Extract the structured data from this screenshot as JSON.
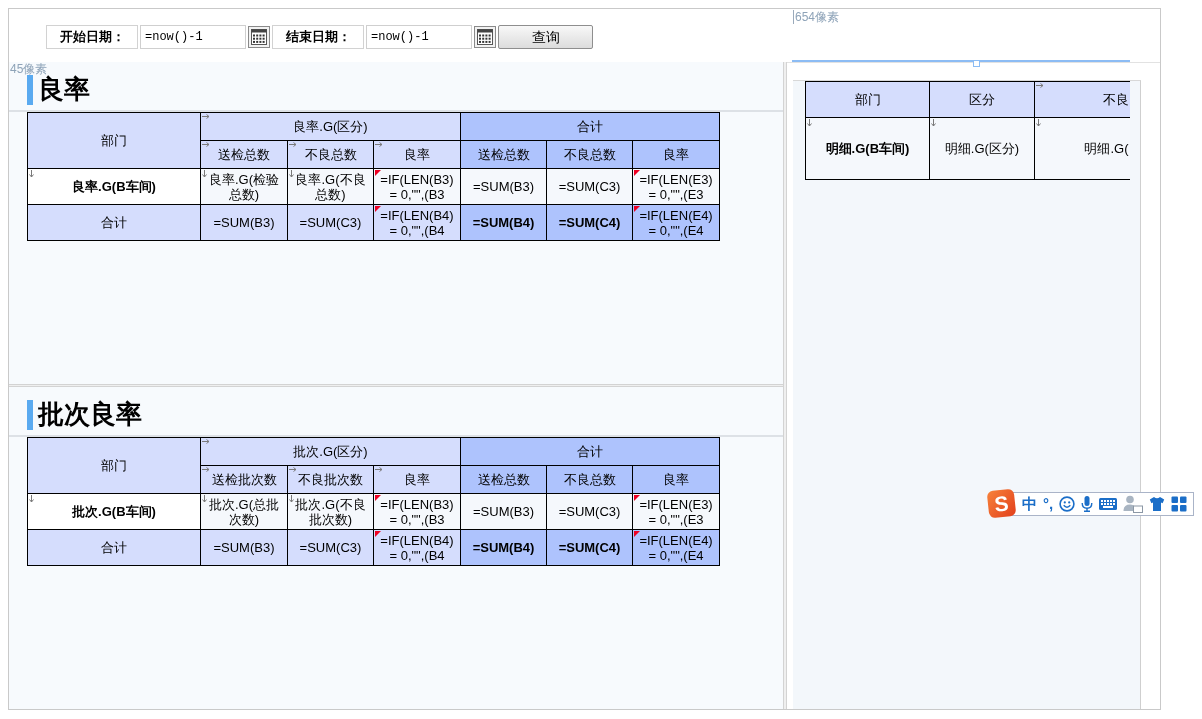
{
  "parameter_bar": {
    "fields": [
      {
        "label": "开始日期：",
        "value": "=now()-1"
      },
      {
        "label": "结束日期：",
        "value": "=now()-1"
      }
    ],
    "query_button": "查询"
  },
  "ruler_labels": {
    "width": "654像素",
    "height": "45像素"
  },
  "reports": [
    {
      "title": "良率",
      "table": {
        "rows": [
          {
            "kind": "header",
            "cells": [
              {
                "text": "部门",
                "rowspan": 2,
                "color": "#d5ddfd",
                "kind": "plain"
              },
              {
                "text": "良率.G(区分)",
                "colspan": 3,
                "color": "#d5ddfd",
                "kind": "expand_across"
              },
              {
                "text": "合计",
                "colspan": 3,
                "color": "#aec3fd",
                "kind": "plain"
              }
            ]
          },
          {
            "kind": "header",
            "cells": [
              {
                "text": "送检总数",
                "color": "#d5ddfd",
                "kind": "expand_across"
              },
              {
                "text": "不良总数",
                "color": "#d5ddfd",
                "kind": "expand_across"
              },
              {
                "text": "良率",
                "color": "#d5ddfd",
                "kind": "expand_across"
              },
              {
                "text": "送检总数",
                "color": "#aec3fd",
                "kind": "plain"
              },
              {
                "text": "不良总数",
                "color": "#aec3fd",
                "kind": "plain"
              },
              {
                "text": "良率",
                "color": "#aec3fd",
                "kind": "plain"
              }
            ]
          },
          {
            "kind": "data",
            "cells": [
              {
                "text": "良率.G(B车间)",
                "color": "#ffffff",
                "bold": true,
                "kind": "expand_down"
              },
              {
                "text": "良率.G(检验总数)",
                "color": "#f5f8fc",
                "kind": "expand_down"
              },
              {
                "text": "良率.G(不良总数)",
                "color": "#f5f8fc",
                "kind": "expand_down"
              },
              {
                "text": "=IF(LEN(B3) = 0,\"\",(B3",
                "color": "#f5f8fc",
                "kind": "comment"
              },
              {
                "text": "=SUM(B3)",
                "color": "#f5f8fc",
                "kind": "plain"
              },
              {
                "text": "=SUM(C3)",
                "color": "#f5f8fc",
                "kind": "plain"
              },
              {
                "text": "=IF(LEN(E3) = 0,\"\",(E3",
                "color": "#f5f8fc",
                "kind": "comment"
              }
            ]
          },
          {
            "kind": "total",
            "cells": [
              {
                "text": "合计",
                "color": "#d5ddfd",
                "kind": "plain"
              },
              {
                "text": "=SUM(B3)",
                "color": "#d5ddfd",
                "kind": "plain"
              },
              {
                "text": "=SUM(C3)",
                "color": "#d5ddfd",
                "kind": "plain"
              },
              {
                "text": "=IF(LEN(B4) = 0,\"\",(B4",
                "color": "#d5ddfd",
                "kind": "comment"
              },
              {
                "text": "=SUM(B4)",
                "color": "#aec3fd",
                "bold": true,
                "kind": "plain"
              },
              {
                "text": "=SUM(C4)",
                "color": "#aec3fd",
                "bold": true,
                "kind": "plain"
              },
              {
                "text": "=IF(LEN(E4) = 0,\"\",(E4",
                "color": "#aec3fd",
                "kind": "comment"
              }
            ]
          }
        ]
      }
    },
    {
      "title": "批次良率",
      "table": {
        "rows": [
          {
            "kind": "header",
            "cells": [
              {
                "text": "部门",
                "rowspan": 2,
                "color": "#d5ddfd",
                "kind": "plain"
              },
              {
                "text": "批次.G(区分)",
                "colspan": 3,
                "color": "#d5ddfd",
                "kind": "expand_across"
              },
              {
                "text": "合计",
                "colspan": 3,
                "color": "#aec3fd",
                "kind": "plain"
              }
            ]
          },
          {
            "kind": "header",
            "cells": [
              {
                "text": "送检批次数",
                "color": "#d5ddfd",
                "kind": "expand_across"
              },
              {
                "text": "不良批次数",
                "color": "#d5ddfd",
                "kind": "expand_across"
              },
              {
                "text": "良率",
                "color": "#d5ddfd",
                "kind": "expand_across"
              },
              {
                "text": "送检总数",
                "color": "#aec3fd",
                "kind": "plain"
              },
              {
                "text": "不良总数",
                "color": "#aec3fd",
                "kind": "plain"
              },
              {
                "text": "良率",
                "color": "#aec3fd",
                "kind": "plain"
              }
            ]
          },
          {
            "kind": "data",
            "cells": [
              {
                "text": "批次.G(B车间)",
                "color": "#ffffff",
                "bold": true,
                "kind": "expand_down"
              },
              {
                "text": "批次.G(总批次数)",
                "color": "#f5f8fc",
                "kind": "expand_down"
              },
              {
                "text": "批次.G(不良批次数)",
                "color": "#f5f8fc",
                "kind": "expand_down"
              },
              {
                "text": "=IF(LEN(B3) = 0,\"\",(B3",
                "color": "#f5f8fc",
                "kind": "comment"
              },
              {
                "text": "=SUM(B3)",
                "color": "#f5f8fc",
                "kind": "plain"
              },
              {
                "text": "=SUM(C3)",
                "color": "#f5f8fc",
                "kind": "plain"
              },
              {
                "text": "=IF(LEN(E3) = 0,\"\",(E3",
                "color": "#f5f8fc",
                "kind": "comment"
              }
            ]
          },
          {
            "kind": "total",
            "cells": [
              {
                "text": "合计",
                "color": "#d5ddfd",
                "kind": "plain"
              },
              {
                "text": "=SUM(B3)",
                "color": "#d5ddfd",
                "kind": "plain"
              },
              {
                "text": "=SUM(C3)",
                "color": "#d5ddfd",
                "kind": "plain"
              },
              {
                "text": "=IF(LEN(B4) = 0,\"\",(B4",
                "color": "#d5ddfd",
                "kind": "comment"
              },
              {
                "text": "=SUM(B4)",
                "color": "#aec3fd",
                "bold": true,
                "kind": "plain"
              },
              {
                "text": "=SUM(C4)",
                "color": "#aec3fd",
                "bold": true,
                "kind": "plain"
              },
              {
                "text": "=IF(LEN(E4) = 0,\"\",(E4",
                "color": "#aec3fd",
                "kind": "comment"
              }
            ]
          }
        ]
      }
    }
  ],
  "detail_table": {
    "columns": [
      {
        "header": "部门",
        "kind": "plain"
      },
      {
        "header": "区分",
        "kind": "plain"
      },
      {
        "header": "不良",
        "kind": "expand_across",
        "cut_off": true
      }
    ],
    "rows": [
      {
        "cells": [
          {
            "text": "明细.G(B车间)",
            "bold": true,
            "kind": "expand_down"
          },
          {
            "text": "明细.G(区分)",
            "kind": "expand_down"
          },
          {
            "text": "明细.G(",
            "kind": "expand_down"
          }
        ]
      }
    ]
  },
  "ime_toolbar": {
    "logo": "S",
    "mode": "中",
    "punctuation": "°,"
  }
}
